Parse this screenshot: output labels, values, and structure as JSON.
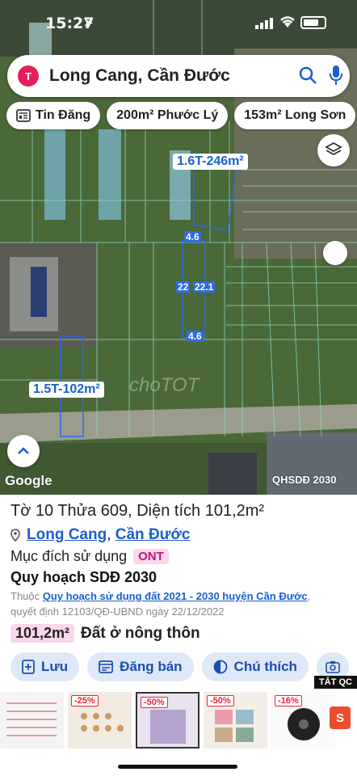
{
  "status_bar": {
    "time": "15:27"
  },
  "search": {
    "query": "Long Cang, Cần Đước",
    "logo_letter": "T"
  },
  "chips": [
    "Tin Đăng",
    "200m² Phước Lý",
    "153m² Long Sơn"
  ],
  "map": {
    "area_labels": [
      "1.6T-246m²",
      "1.5T-102m²"
    ],
    "dimension_labels": {
      "top": "4.6",
      "left": "22",
      "right": "22.1",
      "bottom": "4.6"
    },
    "watermark": "choTOT",
    "google": "Google",
    "layer_source": "QHSDĐ 2030"
  },
  "panel": {
    "parcel_title": "Tờ 10 Thửa 609, Diện tích 101,2m²",
    "location_commune": "Long Cang",
    "location_separator": ", ",
    "location_district": "Cần Đước",
    "purpose_label": "Mục đích sử dụng",
    "purpose_code": "ONT",
    "plan_title": "Quy hoạch SDĐ 2030",
    "plan_desc_prefix": "Thuộc ",
    "plan_desc_link": "Quy hoạch sử dụng đất 2021 - 2030 huyện Cần Đước",
    "plan_desc_suffix": ", quyết định 12103/QĐ-UBND ngày 22/12/2022",
    "area_value": "101,2m²",
    "area_type": "Đất ở nông thôn",
    "actions": {
      "save": "Lưu",
      "post": "Đăng bán",
      "legend": "Chú thích"
    }
  },
  "ads": {
    "close_label": "TẮT QC",
    "discounts": [
      "-25%",
      "-50%",
      "-50%",
      "-16%"
    ],
    "shop_letter": "S"
  },
  "colors": {
    "brand": "#e61e5a",
    "link": "#1a5fd0",
    "badge_bg": "#fbd6ec",
    "button_bg": "#dfe8f7"
  }
}
